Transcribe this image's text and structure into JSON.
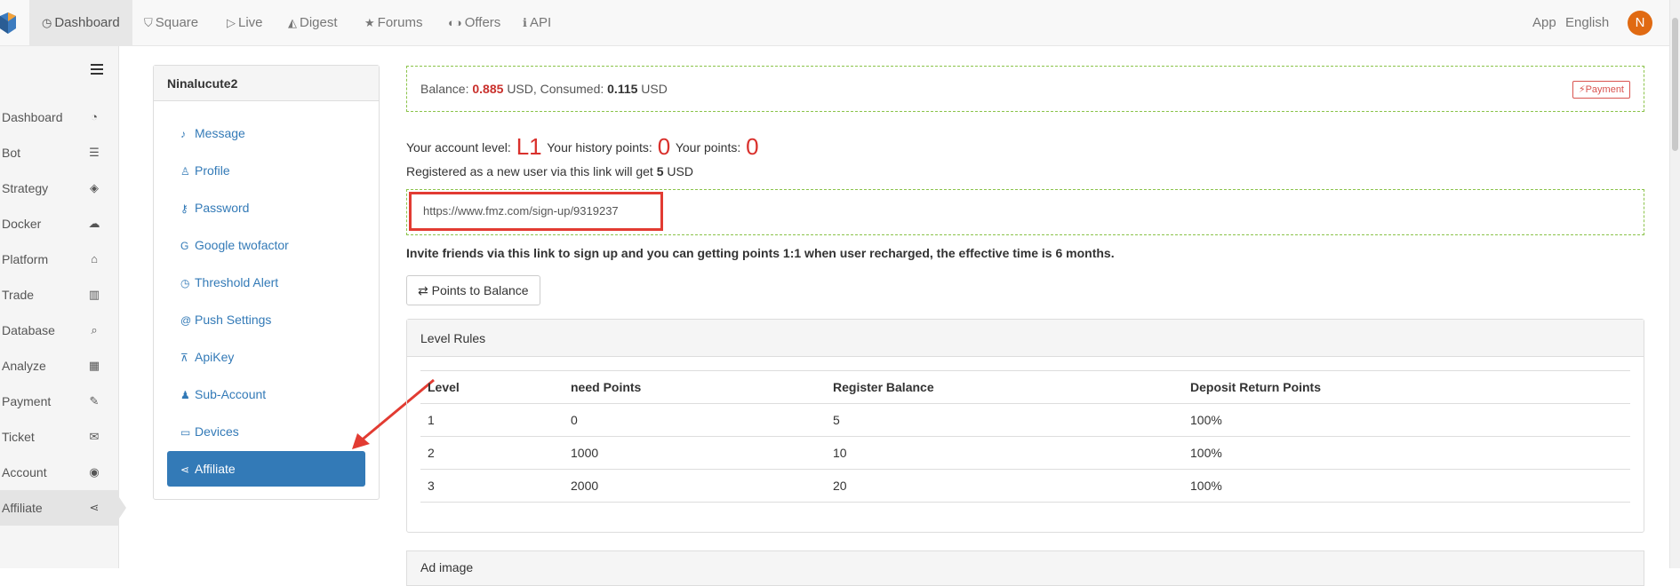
{
  "topbar": {
    "nav": [
      {
        "label": "Dashboard",
        "icon": "dashboard-clock-icon",
        "glyph": "◷"
      },
      {
        "label": "Square",
        "icon": "square-cart-icon",
        "glyph": "⛉"
      },
      {
        "label": "Live",
        "icon": "live-play-icon",
        "glyph": "▷"
      },
      {
        "label": "Digest",
        "icon": "digest-cap-icon",
        "glyph": "◭"
      },
      {
        "label": "Forums",
        "icon": "forums-star-icon",
        "glyph": "★"
      },
      {
        "label": "Offers",
        "icon": "offers-glasses-icon",
        "glyph": "◐◑"
      },
      {
        "label": "API",
        "icon": "api-info-icon",
        "glyph": "ℹ"
      }
    ],
    "app": "App",
    "language": "English",
    "avatar_letter": "N",
    "avatar_color": "#e06a12"
  },
  "sidebar": {
    "items": [
      {
        "label": "Dashboard",
        "icon": "dashboard-gauge-icon",
        "glyph": "◔"
      },
      {
        "label": "Bot",
        "icon": "bot-list-icon",
        "glyph": "☰"
      },
      {
        "label": "Strategy",
        "icon": "strategy-cube-icon",
        "glyph": "◈"
      },
      {
        "label": "Docker",
        "icon": "docker-cloud-icon",
        "glyph": "☁"
      },
      {
        "label": "Platform",
        "icon": "platform-bank-icon",
        "glyph": "⌂"
      },
      {
        "label": "Trade",
        "icon": "trade-chart-icon",
        "glyph": "▥"
      },
      {
        "label": "Database",
        "icon": "database-search-icon",
        "glyph": "⌕"
      },
      {
        "label": "Analyze",
        "icon": "analyze-calculator-icon",
        "glyph": "▦"
      },
      {
        "label": "Payment",
        "icon": "payment-plug-icon",
        "glyph": "✎"
      },
      {
        "label": "Ticket",
        "icon": "ticket-comment-icon",
        "glyph": "✉"
      },
      {
        "label": "Account",
        "icon": "account-user-icon",
        "glyph": "◉"
      },
      {
        "label": "Affiliate",
        "icon": "affiliate-share-icon",
        "glyph": "⋖"
      }
    ]
  },
  "user_panel": {
    "username": "Ninalucute2",
    "menu": [
      {
        "label": "Message",
        "icon": "bell-icon",
        "glyph": "♪"
      },
      {
        "label": "Profile",
        "icon": "profile-user-icon",
        "glyph": "♙"
      },
      {
        "label": "Password",
        "icon": "key-icon",
        "glyph": "⚷"
      },
      {
        "label": "Google twofactor",
        "icon": "google-icon",
        "glyph": "G"
      },
      {
        "label": "Threshold Alert",
        "icon": "clock-icon",
        "glyph": "◷"
      },
      {
        "label": "Push Settings",
        "icon": "at-icon",
        "glyph": "@"
      },
      {
        "label": "ApiKey",
        "icon": "sitemap-icon",
        "glyph": "⊼"
      },
      {
        "label": "Sub-Account",
        "icon": "users-icon",
        "glyph": "♟"
      },
      {
        "label": "Devices",
        "icon": "laptop-icon",
        "glyph": "▭"
      },
      {
        "label": "Affiliate",
        "icon": "share-icon",
        "glyph": "⋖"
      }
    ]
  },
  "balance": {
    "balance_label": "Balance:",
    "balance_value": "0.885",
    "currency1": "USD, Consumed:",
    "consumed_value": "0.115",
    "currency2": "USD",
    "payment_label": "Payment",
    "payment_icon": "bolt-icon"
  },
  "account": {
    "level_label": "Your account level:",
    "level_value": "L1",
    "history_label": "Your history points:",
    "history_value": "0",
    "points_label": "Your points:",
    "points_value": "0",
    "register_prefix": "Registered as a new user via this link will get",
    "register_amount": "5",
    "register_suffix": "USD"
  },
  "invite": {
    "link": "https://www.fmz.com/sign-up/9319237",
    "text": "Invite friends via this link to sign up and you can getting points 1:1 when user recharged, the effective time is 6 months.",
    "button_label": "Points to Balance"
  },
  "rules": {
    "title": "Level Rules",
    "headers": [
      "Level",
      "need Points",
      "Register Balance",
      "Deposit Return Points"
    ],
    "rows": [
      [
        "1",
        "0",
        "5",
        "100%"
      ],
      [
        "2",
        "1000",
        "10",
        "100%"
      ],
      [
        "3",
        "2000",
        "20",
        "100%"
      ]
    ]
  },
  "ad_panel": {
    "title": "Ad image"
  },
  "colors": {
    "accent": "#337ab7",
    "red": "#d9302c",
    "dashed_border": "#8bc34a"
  }
}
